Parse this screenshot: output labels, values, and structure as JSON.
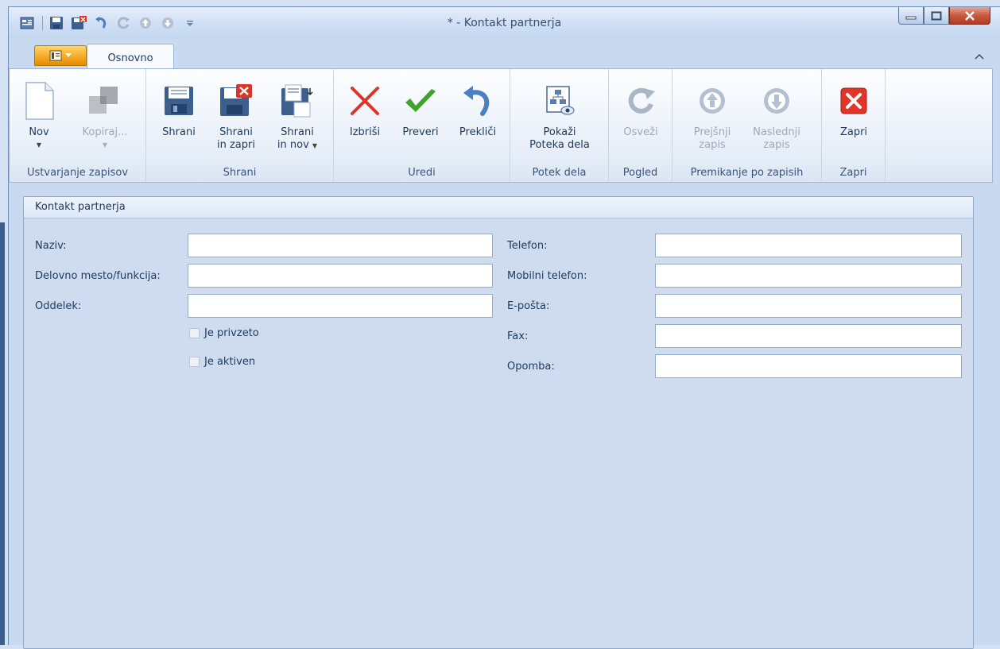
{
  "window": {
    "title": "* - Kontakt partnerja"
  },
  "tabs": {
    "active": "Osnovno"
  },
  "ribbon": {
    "groups": {
      "create": {
        "label": "Ustvarjanje zapisov",
        "new": "Nov",
        "copy": "Kopiraj..."
      },
      "save": {
        "label": "Shrani",
        "save": "Shrani",
        "save_close_1": "Shrani",
        "save_close_2": "in zapri",
        "save_new_1": "Shrani",
        "save_new_2": "in nov"
      },
      "edit": {
        "label": "Uredi",
        "delete": "Izbriši",
        "validate": "Preveri",
        "cancel": "Prekliči"
      },
      "workflow": {
        "label": "Potek dela",
        "show_1": "Pokaži",
        "show_2": "Poteka dela"
      },
      "view": {
        "label": "Pogled",
        "refresh": "Osveži"
      },
      "navigate": {
        "label": "Premikanje po zapisih",
        "prev_1": "Prejšnji",
        "prev_2": "zapis",
        "next_1": "Naslednji",
        "next_2": "zapis"
      },
      "close": {
        "label": "Zapri",
        "close": "Zapri"
      }
    }
  },
  "form": {
    "panel_title": "Kontakt partnerja",
    "left": {
      "name_label": "Naziv:",
      "name_value": "",
      "position_label": "Delovno mesto/funkcija:",
      "position_value": "",
      "department_label": "Oddelek:",
      "department_value": "",
      "default_label": "Je privzeto",
      "default_checked": false,
      "active_label": "Je aktiven",
      "active_checked": false
    },
    "right": {
      "phone_label": "Telefon:",
      "phone_value": "",
      "mobile_label": "Mobilni telefon:",
      "mobile_value": "",
      "email_label": "E-pošta:",
      "email_value": "",
      "fax_label": "Fax:",
      "fax_value": "",
      "note_label": "Opomba:",
      "note_value": ""
    }
  },
  "colors": {
    "accent": "#f5a623",
    "delete_red": "#d9362b",
    "validate_green": "#3fa32b",
    "close_red": "#e2352a"
  }
}
